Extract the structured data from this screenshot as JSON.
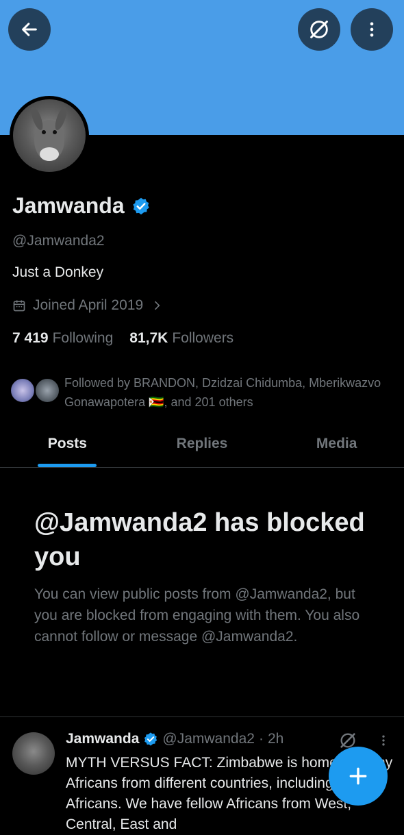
{
  "profile": {
    "display_name": "Jamwanda",
    "handle": "@Jamwanda2",
    "bio": "Just a Donkey",
    "joined": "Joined April 2019",
    "following_count": "7 419",
    "following_label": "Following",
    "followers_count": "81,7K",
    "followers_label": "Followers",
    "followed_by": "Followed by BRANDON, Dzidzai Chidumba, Mberikwazvo Gonawapotera 🇿🇼, and 201 others"
  },
  "tabs": [
    {
      "label": "Posts",
      "active": true
    },
    {
      "label": "Replies",
      "active": false
    },
    {
      "label": "Media",
      "active": false
    }
  ],
  "blocked": {
    "title": "@Jamwanda2 has blocked you",
    "description": "You can view public posts from @Jamwanda2, but you are blocked from engaging with them. You also cannot follow or message @Jamwanda2."
  },
  "post": {
    "name": "Jamwanda",
    "handle": "@Jamwanda2",
    "time": "2h",
    "text": "MYTH VERSUS FACT: Zimbabwe is home to many Africans from different countries, including South Africans. We have fellow Africans from West, Central, East and"
  },
  "icons": {
    "back": "arrow-left-icon",
    "grok": "grok-icon",
    "more": "more-vertical-icon",
    "verified": "verified-badge-icon",
    "calendar": "calendar-icon",
    "compose": "plus-icon"
  },
  "colors": {
    "banner": "#4a9de8",
    "accent": "#1d9bf0",
    "background": "#000000",
    "muted_text": "#71767b"
  }
}
